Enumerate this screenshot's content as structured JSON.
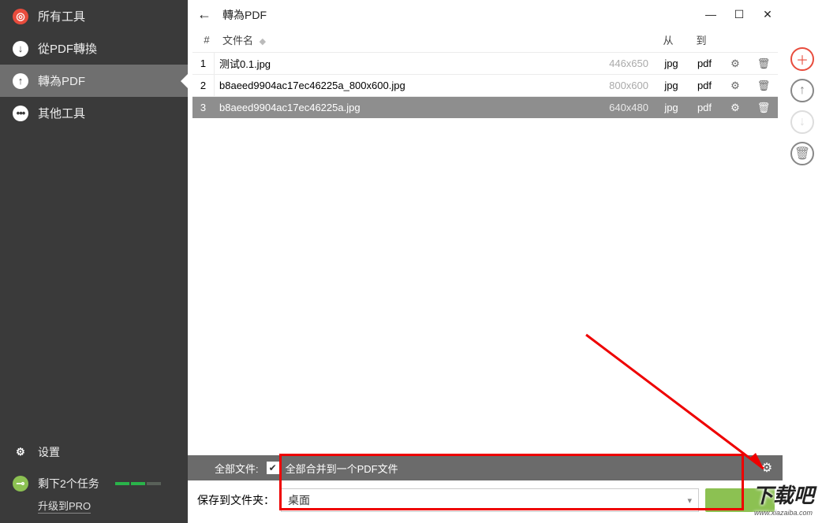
{
  "sidebar": {
    "items": [
      {
        "label": "所有工具",
        "icon": "target"
      },
      {
        "label": "從PDF轉換",
        "icon": "arrow-down"
      },
      {
        "label": "轉為PDF",
        "icon": "arrow-up",
        "active": true
      },
      {
        "label": "其他工具",
        "icon": "dots"
      }
    ],
    "settings_label": "设置",
    "tasks_label": "剩下2个任务",
    "upgrade_label": "升级到PRO"
  },
  "header": {
    "title": "轉為PDF"
  },
  "table": {
    "col_index": "#",
    "col_filename": "文件名",
    "col_from": "从",
    "col_to": "到",
    "rows": [
      {
        "idx": "1",
        "name": "测试0.1.jpg",
        "dim": "446x650",
        "from": "jpg",
        "to": "pdf"
      },
      {
        "idx": "2",
        "name": "b8aeed9904ac17ec46225a_800x600.jpg",
        "dim": "800x600",
        "from": "jpg",
        "to": "pdf"
      },
      {
        "idx": "3",
        "name": "b8aeed9904ac17ec46225a.jpg",
        "dim": "640x480",
        "from": "jpg",
        "to": "pdf",
        "selected": true
      }
    ]
  },
  "merge": {
    "all_files_label": "全部文件:",
    "checkbox_label": "全部合并到一个PDF文件",
    "checked": true
  },
  "save": {
    "label": "保存到文件夹：",
    "value": "桌面"
  },
  "watermark": {
    "big": "下载吧",
    "small": "www.xiazaiba.com"
  }
}
